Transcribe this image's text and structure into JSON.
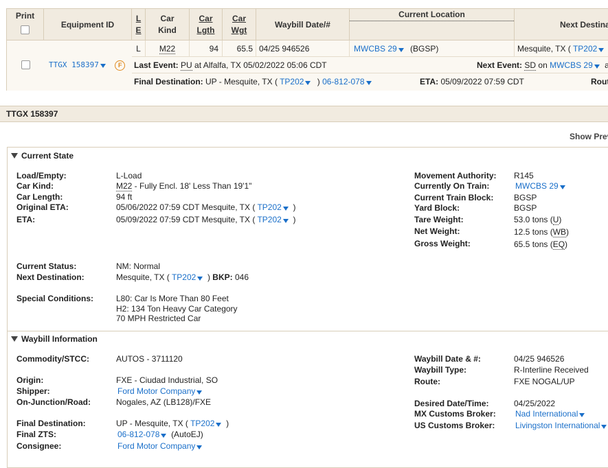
{
  "grid": {
    "headers": {
      "print": "Print",
      "equipment_id": "Equipment ID",
      "le_l": "L",
      "le_e": "E",
      "car_kind_1": "Car",
      "car_kind_2": "Kind",
      "car_lgth_1": "Car",
      "car_lgth_2": "Lgth",
      "car_wgt_1": "Car",
      "car_wgt_2": "Wgt",
      "waybill": "Waybill Date/#",
      "current_location": "Current Location",
      "next_destination": "Next Destina"
    },
    "row": {
      "equipment_id": "TTGX  158397",
      "f_badge": "F",
      "le": "L",
      "car_kind": "M22",
      "car_lgth": "94",
      "car_wgt": "65.5",
      "waybill": "04/25 946526",
      "current_location_link": "MWCBS 29",
      "current_location_extra": "(BGSP)",
      "next_dest_text": "Mesquite, TX (",
      "next_dest_link": "TP202",
      "last_event_label": "Last Event:",
      "last_event_code": "PU",
      "last_event_text": "at Alfalfa, TX 05/02/2022 05:06 CDT",
      "next_event_label": "Next Event:",
      "next_event_code": "SD",
      "next_event_on": "on",
      "next_event_link": "MWCBS 29",
      "next_event_tail": "a",
      "final_dest_label": "Final Destination:",
      "final_dest_text": "UP - Mesquite, TX (",
      "final_dest_link": "TP202",
      "final_dest_close": ")",
      "final_zts_link": "06-812-078",
      "eta_label": "ETA:",
      "eta_value": "05/09/2022 07:59 CDT",
      "rout": "Rout"
    }
  },
  "detail_bar": {
    "title": "TTGX 158397",
    "show_prev": "Show Prev"
  },
  "current_state": {
    "title": "Current State",
    "left": [
      {
        "label": "Load/Empty:",
        "value": "L-Load"
      },
      {
        "label": "Car Kind:",
        "value_u": "M22",
        "value": " - Fully Encl. 18' Less Than 19'1\""
      },
      {
        "label": "Car Length:",
        "value": "94 ft"
      },
      {
        "label": "Original ETA:",
        "value": "05/06/2022 07:59 CDT Mesquite, TX (",
        "link": "TP202",
        "close": ")"
      },
      {
        "label": "ETA:",
        "value": "05/09/2022 07:59 CDT Mesquite, TX (",
        "link": "TP202",
        "close": ")"
      }
    ],
    "right": [
      {
        "label": "Movement Authority:",
        "value": "R145"
      },
      {
        "label": "Currently On Train:",
        "link": "MWCBS 29"
      },
      {
        "label": "Current Train Block:",
        "value": "BGSP"
      },
      {
        "label": "Yard Block:",
        "value": "BGSP"
      },
      {
        "label": "Tare Weight:",
        "value": "53.0 tons (",
        "code": "U",
        "close": ")"
      },
      {
        "label": "Net Weight:",
        "value": "12.5 tons (",
        "code": "WB",
        "close": ")"
      },
      {
        "label": "Gross Weight:",
        "value": "65.5 tons (",
        "code": "EQ",
        "close": ")"
      }
    ],
    "status_label": "Current Status:",
    "status_value": "NM: Normal",
    "next_dest_label": "Next Destination:",
    "next_dest_value": "Mesquite, TX (",
    "next_dest_link": "TP202",
    "bkp_label": "BKP:",
    "bkp_value": "046",
    "special_label": "Special Conditions:",
    "special": [
      "L80: Car Is More Than 80 Feet",
      "H2: 134 Ton Heavy Car Category",
      "70 MPH Restricted Car"
    ]
  },
  "waybill": {
    "title": "Waybill Information",
    "commodity_label": "Commodity/STCC:",
    "commodity_value": "AUTOS - 3711120",
    "origin_label": "Origin:",
    "origin_value": "FXE - Ciudad Industrial, SO",
    "shipper_label": "Shipper:",
    "shipper_link": "Ford Motor Company",
    "junction_label": "On-Junction/Road:",
    "junction_value": "Nogales, AZ (LB128)/FXE",
    "final_dest_label": "Final Destination:",
    "final_dest_value": "UP - Mesquite, TX (",
    "final_dest_link": "TP202",
    "final_zts_label": "Final ZTS:",
    "final_zts_link": "06-812-078",
    "final_zts_extra": "(AutoEJ)",
    "consignee_label": "Consignee:",
    "consignee_link": "Ford Motor Company",
    "wb_date_label": "Waybill Date & #:",
    "wb_date_value": "04/25 946526",
    "wb_type_label": "Waybill Type:",
    "wb_type_value": "R-Interline Received",
    "route_label": "Route:",
    "route_value": "FXE NOGAL/UP",
    "desired_label": "Desired Date/Time:",
    "desired_value": "04/25/2022",
    "mx_label": "MX Customs Broker:",
    "mx_link": "Nad International",
    "us_label": "US Customs Broker:",
    "us_link": "Livingston International"
  }
}
